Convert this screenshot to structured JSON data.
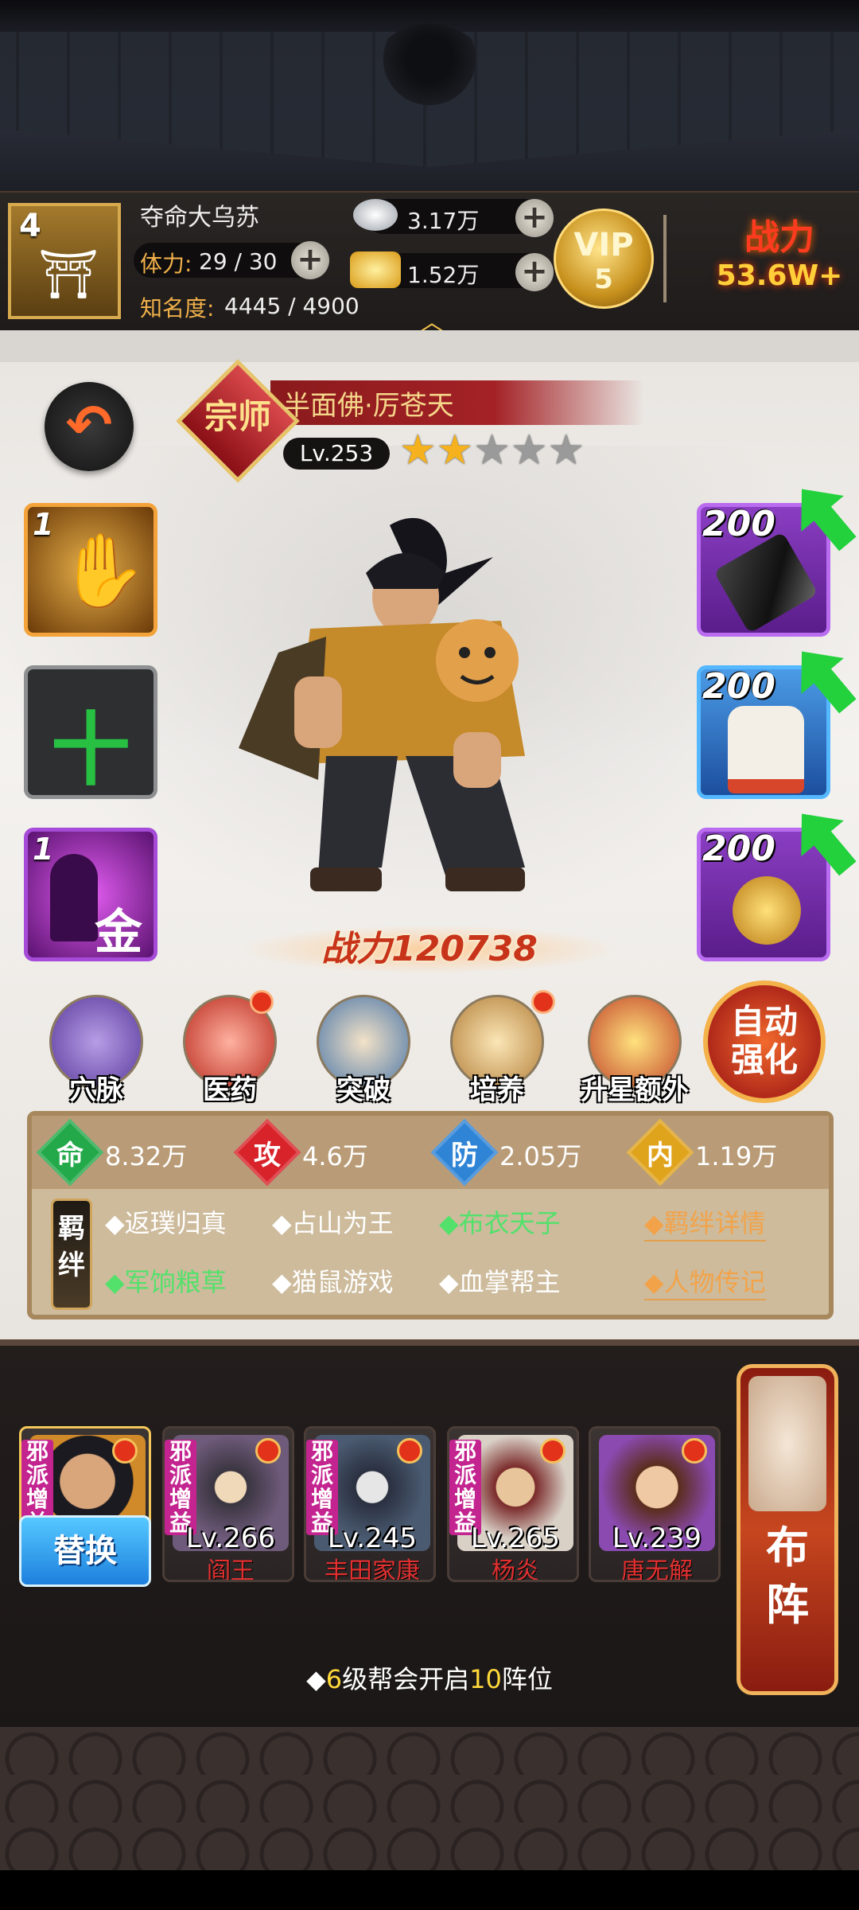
{
  "header": {
    "player_level": "4",
    "player_name": "夺命大乌苏",
    "stamina_label": "体力:",
    "stamina_value": "29 / 30",
    "fame_label": "知名度:",
    "fame_value": "4445 / 4900",
    "silver": "3.17万",
    "gold": "1.52万",
    "vip_label": "VIP",
    "vip_level": "5",
    "power_label": "战力",
    "power_value": "53.6W+"
  },
  "hero": {
    "grade": "宗师",
    "name": "半面佛·厉苍天",
    "level": "Lv.253",
    "stars_filled": 2,
    "stars_total": 5,
    "power": "战力120738",
    "back_icon": "return-arrow-icon"
  },
  "skills": [
    {
      "count": "1",
      "icon": "palm-icon"
    },
    {
      "count": "",
      "icon": "plus-icon",
      "glyph": "十"
    },
    {
      "count": "1",
      "icon": "gold-figure-icon",
      "glyph": "金"
    }
  ],
  "equipment": [
    {
      "level": "200",
      "icon": "gauntlet-icon"
    },
    {
      "level": "200",
      "icon": "robe-icon"
    },
    {
      "level": "200",
      "icon": "jade-pendant-icon"
    }
  ],
  "functions": [
    {
      "label": "穴脉",
      "dot": false
    },
    {
      "label": "医药",
      "dot": true
    },
    {
      "label": "突破",
      "dot": false
    },
    {
      "label": "培养",
      "dot": true
    },
    {
      "label": "升星额外",
      "dot": false
    }
  ],
  "auto_enhance": {
    "line1": "自动",
    "line2": "强化"
  },
  "stats": [
    {
      "label": "命",
      "value": "8.32万",
      "color": "#23a94a"
    },
    {
      "label": "攻",
      "value": "4.6万",
      "color": "#d8232a"
    },
    {
      "label": "防",
      "value": "2.05万",
      "color": "#2f84d6"
    },
    {
      "label": "内",
      "value": "1.19万",
      "color": "#e0a31c"
    }
  ],
  "bonds": {
    "title_line1": "羁",
    "title_line2": "绊",
    "items": [
      {
        "text": "◆返璞归真",
        "active": false
      },
      {
        "text": "◆占山为王",
        "active": false
      },
      {
        "text": "◆布衣天子",
        "active": true
      },
      {
        "text": "◆军饷粮草",
        "active": true
      },
      {
        "text": "◆猫鼠游戏",
        "active": false
      },
      {
        "text": "◆血掌帮主",
        "active": false
      }
    ],
    "detail_link": "◆羁绊详情",
    "bio_link": "◆人物传记"
  },
  "team": {
    "swap_label": "替换",
    "members": [
      {
        "tag": "邪派增益",
        "level": "",
        "name": ""
      },
      {
        "tag": "邪派增益",
        "level": "Lv.266",
        "name": "阎王"
      },
      {
        "tag": "邪派增益",
        "level": "Lv.245",
        "name": "丰田家康"
      },
      {
        "tag": "邪派增益",
        "level": "Lv.265",
        "name": "杨炎"
      },
      {
        "tag": "",
        "level": "Lv.239",
        "name": "唐无解"
      }
    ],
    "formation_line1": "布",
    "formation_line2": "阵",
    "note_prefix": "◆",
    "note_num1": "6",
    "note_mid": "级帮会开启",
    "note_num2": "10",
    "note_suffix": "阵位"
  }
}
